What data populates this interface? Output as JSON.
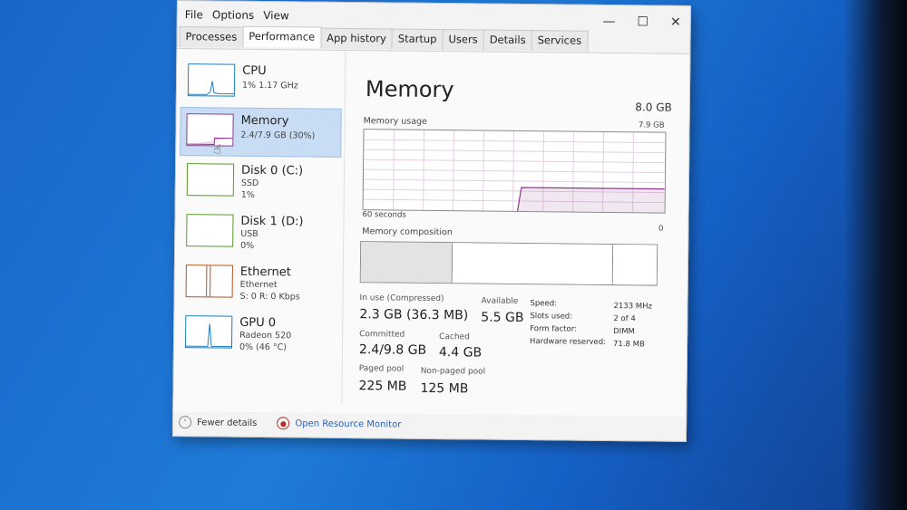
{
  "menu": [
    "File",
    "Options",
    "View"
  ],
  "window_controls": [
    "minimize-icon",
    "maximize-icon",
    "close-icon"
  ],
  "tabs": [
    "Processes",
    "Performance",
    "App history",
    "Startup",
    "Users",
    "Details",
    "Services"
  ],
  "active_tab": "Performance",
  "resources": [
    {
      "title": "CPU",
      "line1": "1% 1.17 GHz",
      "line2": ""
    },
    {
      "title": "Memory",
      "line1": "2.4/7.9 GB (30%)",
      "line2": ""
    },
    {
      "title": "Disk 0 (C:)",
      "line1": "SSD",
      "line2": "1%"
    },
    {
      "title": "Disk 1 (D:)",
      "line1": "USB",
      "line2": "0%"
    },
    {
      "title": "Ethernet",
      "line1": "Ethernet",
      "line2": "S: 0 R: 0 Kbps"
    },
    {
      "title": "GPU 0",
      "line1": "Radeon 520",
      "line2": "0% (46 °C)"
    }
  ],
  "main": {
    "title": "Memory",
    "total": "8.0 GB",
    "usage_label": "Memory usage",
    "usage_max": "7.9 GB",
    "time_label": "60 seconds",
    "zero_label": "0",
    "composition_label": "Memory composition",
    "in_use_label": "In use (Compressed)",
    "in_use_value": "2.3 GB (36.3 MB)",
    "available_label": "Available",
    "available_value": "5.5 GB",
    "committed_label": "Committed",
    "committed_value": "2.4/9.8 GB",
    "cached_label": "Cached",
    "cached_value": "4.4 GB",
    "paged_label": "Paged pool",
    "paged_value": "225 MB",
    "nonpaged_label": "Non-paged pool",
    "nonpaged_value": "125 MB",
    "details": [
      {
        "k": "Speed:",
        "v": "2133 MHz"
      },
      {
        "k": "Slots used:",
        "v": "2 of 4"
      },
      {
        "k": "Form factor:",
        "v": "DIMM"
      },
      {
        "k": "Hardware reserved:",
        "v": "71.8 MB"
      }
    ]
  },
  "footer": {
    "fewer": "Fewer details",
    "monitor": "Open Resource Monitor"
  },
  "colors": {
    "memory": "#8b3a8b",
    "selection": "#c8dcf3",
    "cpu": "#1a7fc0",
    "ethernet": "#b3541e"
  }
}
